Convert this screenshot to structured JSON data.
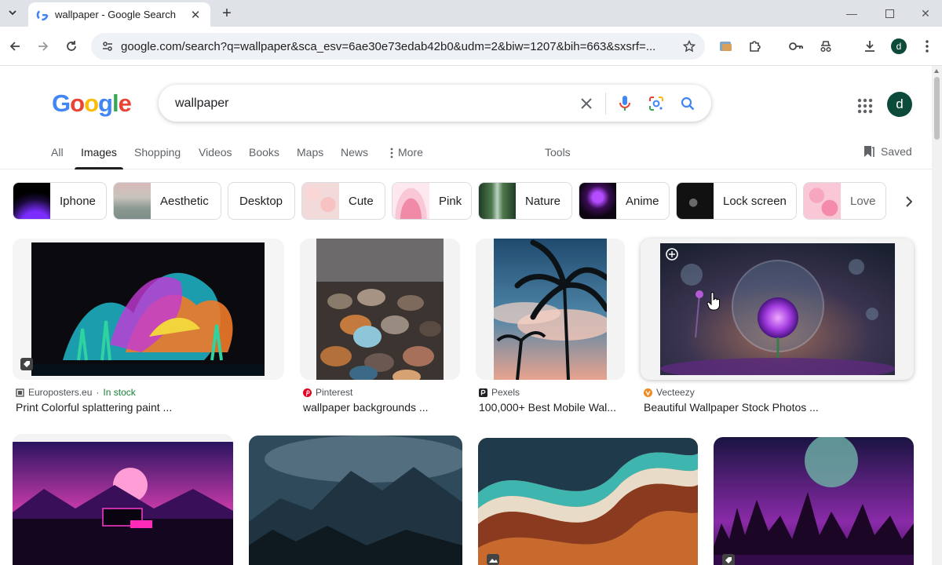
{
  "browser": {
    "tab_title": "wallpaper - Google Search",
    "url": "google.com/search?q=wallpaper&sca_esv=6ae30e73edab42b0&udm=2&biw=1207&bih=663&sxsrf=...",
    "profile_initial": "d"
  },
  "google": {
    "logo": [
      "G",
      "o",
      "o",
      "g",
      "l",
      "e"
    ],
    "logo_colors": [
      "#4285F4",
      "#EA4335",
      "#FBBC05",
      "#4285F4",
      "#34A853",
      "#EA4335"
    ],
    "query": "wallpaper",
    "avatar_initial": "d",
    "tabs": [
      {
        "label": "All"
      },
      {
        "label": "Images"
      },
      {
        "label": "Shopping"
      },
      {
        "label": "Videos"
      },
      {
        "label": "Books"
      },
      {
        "label": "Maps"
      },
      {
        "label": "News"
      },
      {
        "label": "More"
      },
      {
        "label": "Tools"
      }
    ],
    "saved_label": "Saved",
    "chips": [
      {
        "label": "Iphone"
      },
      {
        "label": "Aesthetic"
      },
      {
        "label": "Desktop"
      },
      {
        "label": "Cute"
      },
      {
        "label": "Pink"
      },
      {
        "label": "Nature"
      },
      {
        "label": "Anime"
      },
      {
        "label": "Lock screen"
      },
      {
        "label": "Love"
      }
    ],
    "results": [
      {
        "source": "Europosters.eu",
        "stock": "In stock",
        "title": "Print Colorful splattering paint ..."
      },
      {
        "source": "Pinterest",
        "title": "wallpaper backgrounds ..."
      },
      {
        "source": "Pexels",
        "title": "100,000+ Best Mobile Wal..."
      },
      {
        "source": "Vecteezy",
        "title": "Beautiful Wallpaper Stock Photos ..."
      }
    ]
  },
  "colors": {
    "accent": "#1a73e8",
    "avatar": "#0c4a3a"
  }
}
